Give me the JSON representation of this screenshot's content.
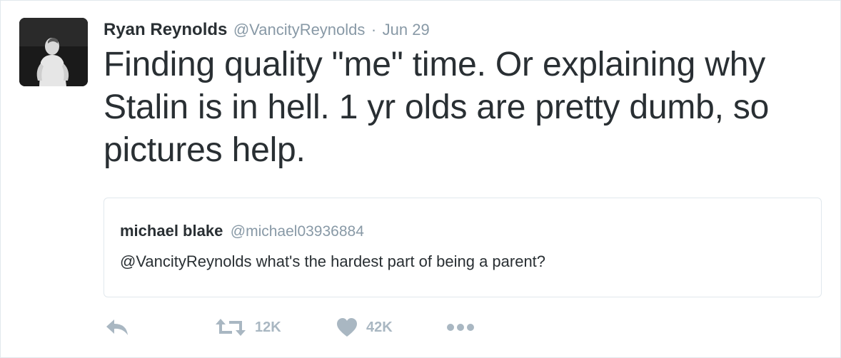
{
  "tweet": {
    "author_name": "Ryan Reynolds",
    "author_handle": "@VancityReynolds",
    "separator": "·",
    "date": "Jun 29",
    "text": "Finding quality \"me\" time. Or explaining why\nStalin is in hell. 1 yr olds are pretty dumb, so\npictures help."
  },
  "quoted_tweet": {
    "author_name": "michael blake",
    "author_handle": "@michael03936884",
    "text": "@VancityReynolds what's the hardest part of being a parent?"
  },
  "actions": {
    "reply_icon": "reply-icon",
    "retweet_icon": "retweet-icon",
    "retweet_count": "12K",
    "like_icon": "heart-icon",
    "like_count": "42K",
    "more_icon": "more-dots-icon"
  },
  "colors": {
    "text": "#292f33",
    "secondary": "#8899a6",
    "action_icons": "#a9b7c2",
    "border": "#e1e8ed"
  }
}
